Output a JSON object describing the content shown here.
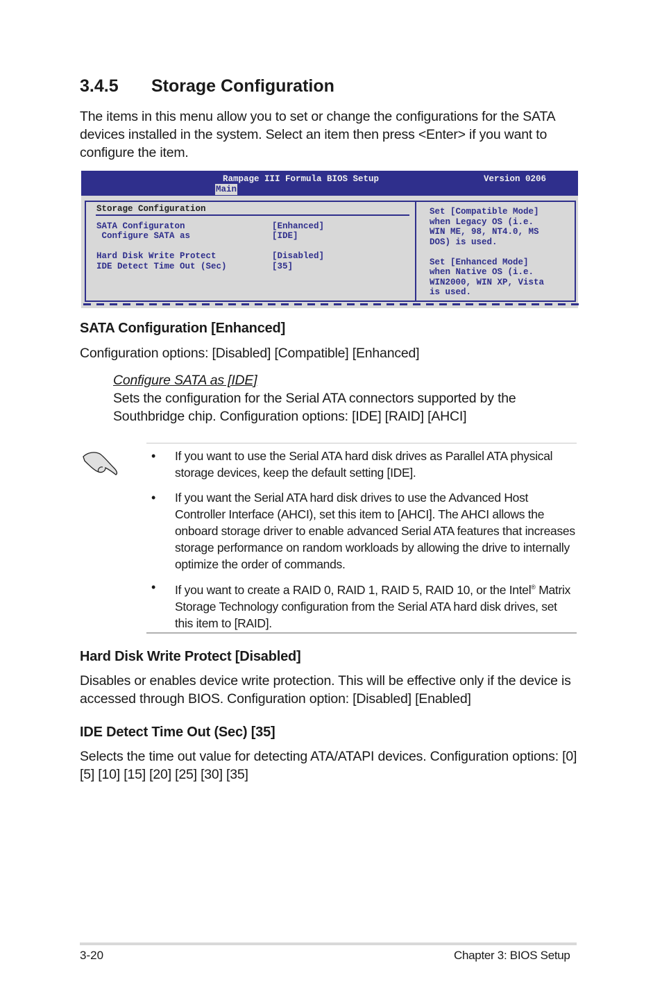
{
  "section": {
    "number": "3.4.5",
    "title": "Storage Configuration",
    "intro": "The items in this menu allow you to set or change the configurations for the SATA devices installed in the system. Select an item then press <Enter> if you want to configure the item."
  },
  "bios": {
    "title": "Rampage III Formula BIOS Setup",
    "version": "Version 0206",
    "active_tab": "Main",
    "menu_title": "Storage Configuration",
    "items": [
      {
        "label": "SATA Configuraton",
        "value": "[Enhanced]"
      },
      {
        "label": " Configure SATA as",
        "value": "[IDE]"
      },
      {
        "label": "Hard Disk Write Protect",
        "value": "[Disabled]"
      },
      {
        "label": "IDE Detect Time Out (Sec)",
        "value": "[35]"
      }
    ],
    "help_text": "Set [Compatible Mode]\nwhen Legacy OS (i.e.\nWIN ME, 98, NT4.0, MS\nDOS) is used.\n\nSet [Enhanced Mode]\nwhen Native OS (i.e.\nWIN2000, WIN XP, Vista\nis used.",
    "colors": {
      "header": "#2f2f8c",
      "background": "#d8d8d8",
      "text": "#2f2f8c"
    }
  },
  "sata_config": {
    "heading": "SATA Configuration [Enhanced]",
    "options": "Configuration options: [Disabled] [Compatible] [Enhanced]",
    "sub_heading": "Configure SATA as [IDE]",
    "sub_text": "Sets the configuration for the Serial ATA connectors supported by the Southbridge chip. Configuration options: [IDE] [RAID] [AHCI]"
  },
  "note": {
    "icon": "pointing-hand-icon",
    "bullet_glyph": "•",
    "bullets": [
      "If you want to use the Serial ATA hard disk drives as Parallel ATA physical storage devices, keep the default setting [IDE].",
      "If you want the Serial ATA hard disk drives to use the Advanced Host Controller Interface (AHCI), set this item to [AHCI]. The AHCI allows the onboard storage driver to enable advanced Serial ATA features that increases storage performance on random workloads by allowing the drive to internally optimize the order of commands.",
      {
        "before": "If you want to create a RAID 0, RAID 1, RAID 5, RAID 10, or the Intel",
        "sup": "®",
        "after": " Matrix Storage Technology configuration from the Serial ATA hard disk drives, set this item to [RAID]."
      }
    ]
  },
  "write_protect": {
    "heading": "Hard Disk Write Protect [Disabled]",
    "text": "Disables or enables device write protection. This will be effective only if the device is accessed through BIOS. Configuration option: [Disabled] [Enabled]"
  },
  "ide_timeout": {
    "heading": "IDE Detect Time Out (Sec) [35]",
    "text": "Selects the time out value for detecting ATA/ATAPI devices. Configuration options: [0] [5] [10] [15] [20] [25] [30] [35]"
  },
  "footer": {
    "page_number": "3-20",
    "chapter": "Chapter 3: BIOS Setup"
  }
}
